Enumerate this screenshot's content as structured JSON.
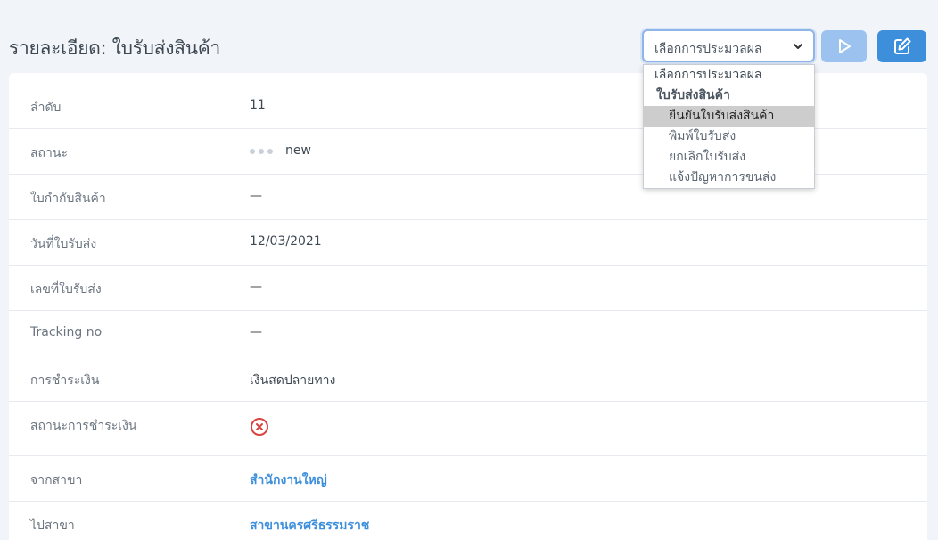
{
  "page": {
    "title": "รายละเอียด: ใบรับส่งสินค้า"
  },
  "toolbar": {
    "process_select": {
      "selected": "เลือกการประมวลผล",
      "options": [
        {
          "label": "เลือกการประมวลผล",
          "kind": "placeholder"
        },
        {
          "label": "ใบรับส่งสินค้า",
          "kind": "group"
        },
        {
          "label": "ยืนยันใบรับส่งสินค้า",
          "kind": "option",
          "highlighted": true
        },
        {
          "label": "พิมพ์ใบรับส่ง",
          "kind": "option"
        },
        {
          "label": "ยกเลิกใบรับส่ง",
          "kind": "option"
        },
        {
          "label": "แจ้งปัญหาการขนส่ง",
          "kind": "option"
        }
      ]
    },
    "run_icon": "play-icon",
    "edit_icon": "edit-icon"
  },
  "details": {
    "rows": [
      {
        "label": "ลำดับ",
        "value": "11"
      },
      {
        "label": "สถานะ",
        "value": "new"
      },
      {
        "label": "ใบกำกับสินค้า",
        "value": "—"
      },
      {
        "label": "วันที่ใบรับส่ง",
        "value": "12/03/2021"
      },
      {
        "label": "เลขที่ใบรับส่ง",
        "value": "—"
      },
      {
        "label": "Tracking no",
        "value": "—"
      },
      {
        "label": "การชำระเงิน",
        "value": "เงินสดปลายทาง"
      },
      {
        "label": "สถานะการชำระเงิน",
        "value_icon": "x-circle-icon"
      },
      {
        "label": "จากสาขา",
        "value": "สำนักงานใหญ่"
      },
      {
        "label": "ไปสาขา",
        "value": "สาขานครศรีธรรมราช"
      }
    ]
  },
  "colors": {
    "accent": "#3d8fdb",
    "accent_light": "#9cc3ef",
    "error": "#d9443f",
    "background": "#f1f4f8"
  }
}
